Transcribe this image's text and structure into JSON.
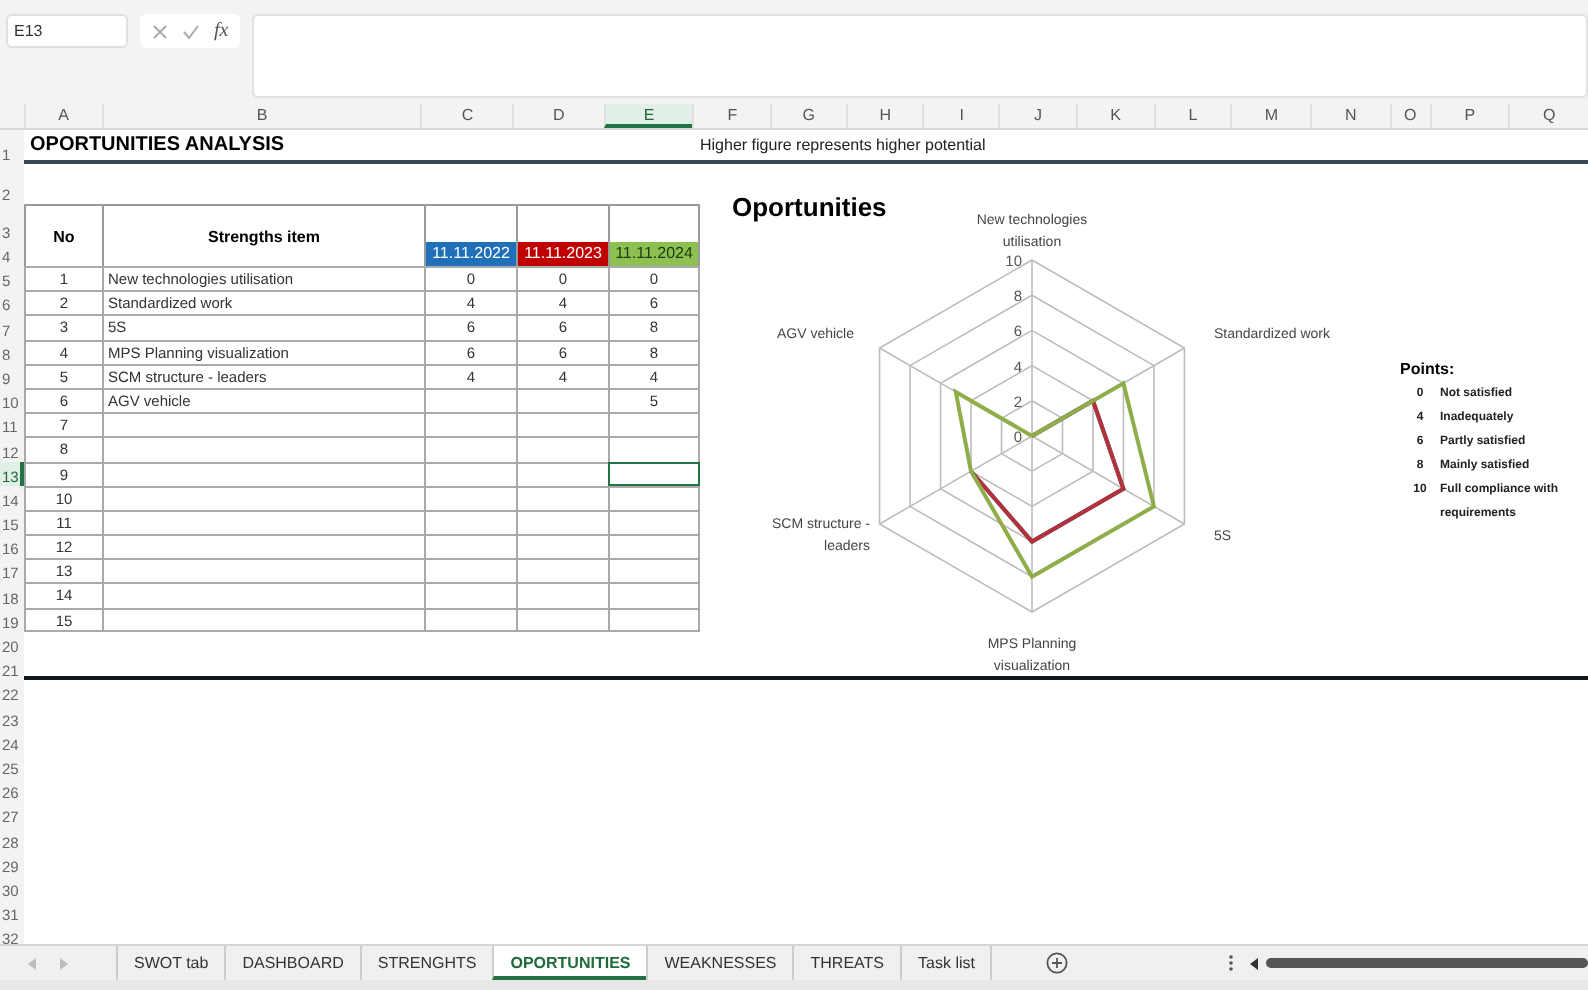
{
  "formula_bar": {
    "name_box": "E13",
    "function_label": "fx"
  },
  "columns": [
    {
      "label": "A",
      "selected": false
    },
    {
      "label": "B",
      "selected": false
    },
    {
      "label": "C",
      "selected": false
    },
    {
      "label": "D",
      "selected": false
    },
    {
      "label": "E",
      "selected": true
    },
    {
      "label": "F",
      "selected": false
    },
    {
      "label": "G",
      "selected": false
    },
    {
      "label": "H",
      "selected": false
    },
    {
      "label": "I",
      "selected": false
    },
    {
      "label": "J",
      "selected": false
    },
    {
      "label": "K",
      "selected": false
    },
    {
      "label": "L",
      "selected": false
    },
    {
      "label": "M",
      "selected": false
    },
    {
      "label": "N",
      "selected": false
    },
    {
      "label": "O",
      "selected": false
    },
    {
      "label": "P",
      "selected": false
    },
    {
      "label": "Q",
      "selected": false
    }
  ],
  "row_numbers": [
    {
      "label": "1",
      "selected": false
    },
    {
      "label": "2",
      "selected": false
    },
    {
      "label": "3",
      "selected": false
    },
    {
      "label": "4",
      "selected": false
    },
    {
      "label": "5",
      "selected": false
    },
    {
      "label": "6",
      "selected": false
    },
    {
      "label": "7",
      "selected": false
    },
    {
      "label": "8",
      "selected": false
    },
    {
      "label": "9",
      "selected": false
    },
    {
      "label": "10",
      "selected": false
    },
    {
      "label": "11",
      "selected": false
    },
    {
      "label": "12",
      "selected": false
    },
    {
      "label": "13",
      "selected": true
    },
    {
      "label": "14",
      "selected": false
    },
    {
      "label": "15",
      "selected": false
    },
    {
      "label": "16",
      "selected": false
    },
    {
      "label": "17",
      "selected": false
    },
    {
      "label": "18",
      "selected": false
    },
    {
      "label": "19",
      "selected": false
    },
    {
      "label": "20",
      "selected": false
    },
    {
      "label": "21",
      "selected": false
    },
    {
      "label": "22",
      "selected": false
    },
    {
      "label": "23",
      "selected": false
    },
    {
      "label": "24",
      "selected": false
    },
    {
      "label": "25",
      "selected": false
    },
    {
      "label": "26",
      "selected": false
    },
    {
      "label": "27",
      "selected": false
    },
    {
      "label": "28",
      "selected": false
    },
    {
      "label": "29",
      "selected": false
    },
    {
      "label": "30",
      "selected": false
    },
    {
      "label": "31",
      "selected": false
    },
    {
      "label": "32",
      "selected": false
    }
  ],
  "sheet": {
    "title": "OPORTUNITIES ANALYSIS",
    "note": "Higher figure represents higher potential"
  },
  "table": {
    "no_header": "No",
    "item_header": "Strengths item",
    "dates": [
      {
        "label": "11.11.2022",
        "color": "#1f70b8"
      },
      {
        "label": "11.11.2023",
        "color": "#c00000"
      },
      {
        "label": "11.11.2024",
        "color": "#8cc152"
      }
    ],
    "rows": [
      {
        "no": "1",
        "item": "New technologies utilisation",
        "values": [
          "0",
          "0",
          "0"
        ],
        "selected_value": false
      },
      {
        "no": "2",
        "item": "Standardized work",
        "values": [
          "4",
          "4",
          "6"
        ],
        "selected_value": false
      },
      {
        "no": "3",
        "item": "5S",
        "values": [
          "6",
          "6",
          "8"
        ],
        "selected_value": false
      },
      {
        "no": "4",
        "item": "MPS Planning visualization",
        "values": [
          "6",
          "6",
          "8"
        ],
        "selected_value": false
      },
      {
        "no": "5",
        "item": "SCM structure - leaders",
        "values": [
          "4",
          "4",
          "4"
        ],
        "selected_value": false
      },
      {
        "no": "6",
        "item": "AGV vehicle",
        "values": {
          "2": "5"
        },
        "selected_value": false
      },
      {
        "no": "7",
        "selected_value": false
      },
      {
        "no": "8",
        "selected_value": false
      },
      {
        "no": "9",
        "selected_value": true
      },
      {
        "no": "10",
        "selected_value": false
      },
      {
        "no": "11",
        "selected_value": false
      },
      {
        "no": "12",
        "selected_value": false
      },
      {
        "no": "13",
        "selected_value": false
      },
      {
        "no": "14",
        "selected_value": false
      },
      {
        "no": "15",
        "selected_value": false
      }
    ]
  },
  "chart": {
    "title": "Oportunities",
    "categories": [
      "New technologies utilisation",
      "AGV vehicle",
      "Standardized work",
      "SCM structure - leaders",
      "5S",
      "MPS Planning visualization"
    ],
    "ticks": [
      "10",
      "8",
      "6",
      "4",
      "2",
      "0"
    ]
  },
  "legend": {
    "title": "Points:",
    "items": [
      {
        "points": "0",
        "text": "Not satisfied"
      },
      {
        "points": "4",
        "text": "Inadequately"
      },
      {
        "points": "6",
        "text": "Partly satisfied"
      },
      {
        "points": "8",
        "text": "Mainly satisfied"
      },
      {
        "points": "10",
        "text": "Full compliance with requirements"
      }
    ]
  },
  "sheet_tabs": [
    {
      "label": "SWOT tab",
      "selected": false
    },
    {
      "label": "DASHBOARD",
      "selected": false
    },
    {
      "label": "STRENGHTS",
      "selected": false
    },
    {
      "label": "OPORTUNITIES",
      "selected": true
    },
    {
      "label": "WEAKNESSES",
      "selected": false
    },
    {
      "label": "THREATS",
      "selected": false
    },
    {
      "label": "Task list",
      "selected": false
    }
  ]
}
